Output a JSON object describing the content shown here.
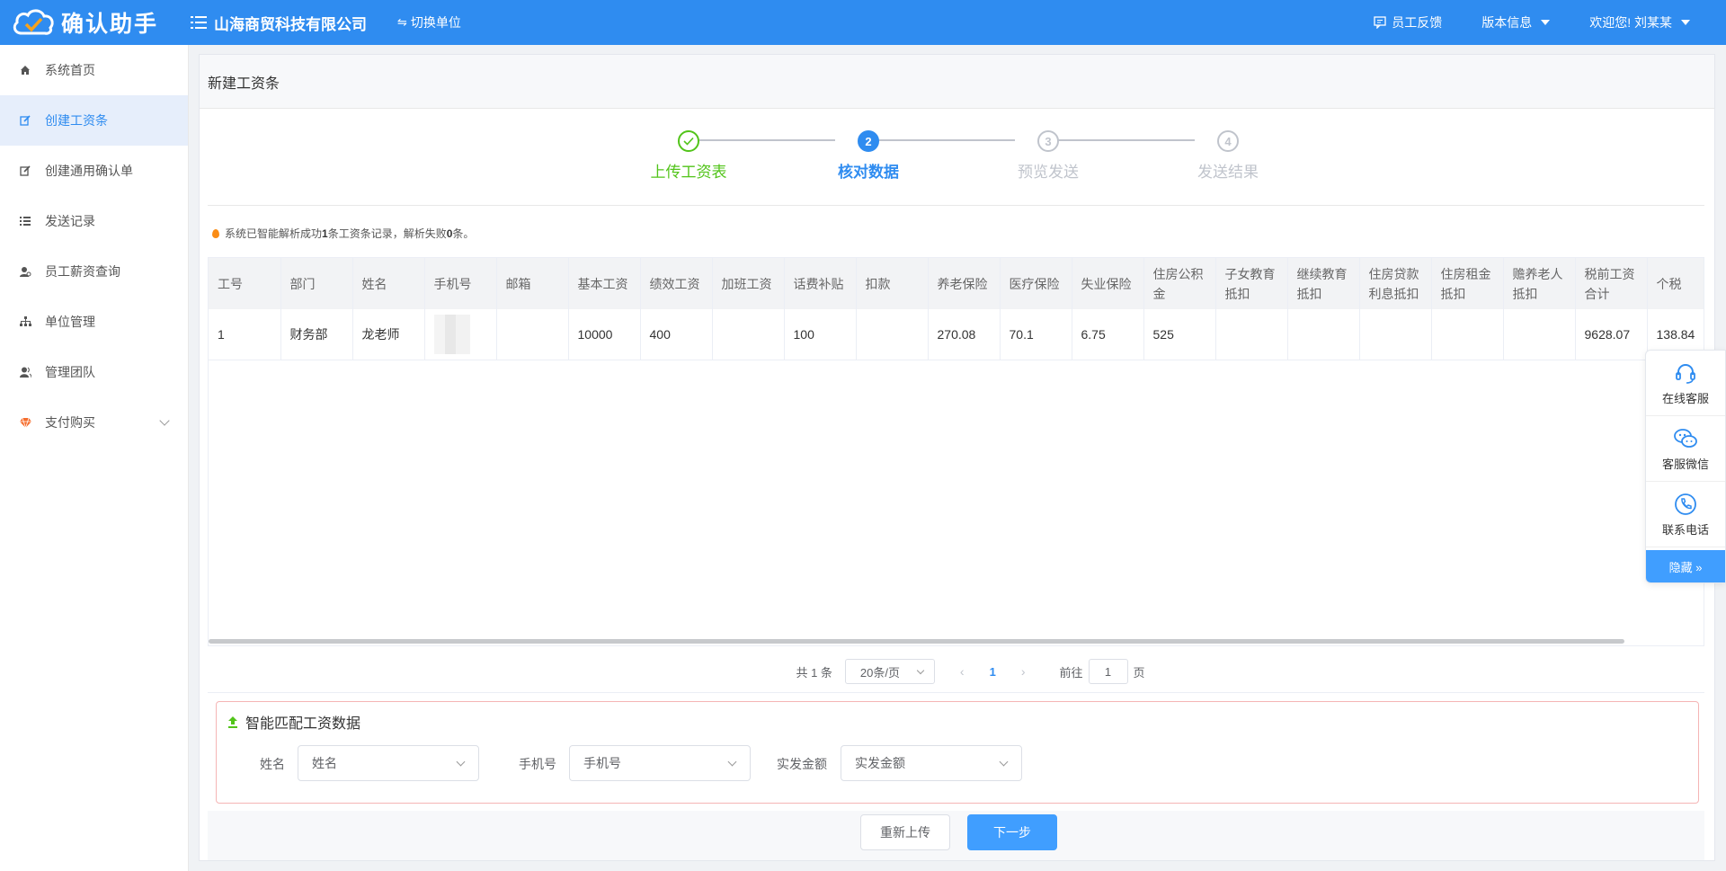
{
  "header": {
    "app_name": "确认助手",
    "company": "山海商贸科技有限公司",
    "switch_unit": "切换单位",
    "feedback": "员工反馈",
    "version": "版本信息",
    "welcome": "欢迎您! 刘某某"
  },
  "sidebar": {
    "items": [
      {
        "label": "系统首页",
        "icon": "home-icon"
      },
      {
        "label": "创建工资条",
        "icon": "edit-icon"
      },
      {
        "label": "创建通用确认单",
        "icon": "edit-icon"
      },
      {
        "label": "发送记录",
        "icon": "list-icon"
      },
      {
        "label": "员工薪资查询",
        "icon": "user-search-icon"
      },
      {
        "label": "单位管理",
        "icon": "org-icon"
      },
      {
        "label": "管理团队",
        "icon": "team-icon"
      },
      {
        "label": "支付购买",
        "icon": "diamond-icon"
      }
    ],
    "active_index": 1
  },
  "page": {
    "title": "新建工资条",
    "steps": [
      {
        "num": "1",
        "label": "上传工资表",
        "state": "done"
      },
      {
        "num": "2",
        "label": "核对数据",
        "state": "active"
      },
      {
        "num": "3",
        "label": "预览发送",
        "state": "wait"
      },
      {
        "num": "4",
        "label": "发送结果",
        "state": "wait"
      }
    ],
    "notice_prefix": "系统已智能解析成功",
    "notice_success": "1",
    "notice_mid": "条工资条记录，解析失败",
    "notice_fail": "0",
    "notice_suffix": "条。"
  },
  "table": {
    "columns": [
      "工号",
      "部门",
      "姓名",
      "手机号",
      "邮箱",
      "基本工资",
      "绩效工资",
      "加班工资",
      "话费补贴",
      "扣款",
      "养老保险",
      "医疗保险",
      "失业保险",
      "住房公积金",
      "子女教育抵扣",
      "继续教育抵扣",
      "住房贷款利息抵扣",
      "住房租金抵扣",
      "赡养老人抵扣",
      "税前工资合计",
      "个税"
    ],
    "rows": [
      [
        "1",
        "财务部",
        "龙老师",
        "",
        "",
        "10000",
        "400",
        "",
        "100",
        "",
        "270.08",
        "70.1",
        "6.75",
        "525",
        "",
        "",
        "",
        "",
        "",
        "9628.07",
        "138.84"
      ]
    ]
  },
  "pagination": {
    "total": "共 1 条",
    "page_size": "20条/页",
    "current": "1",
    "goto_label": "前往",
    "goto_value": "1",
    "page_unit": "页"
  },
  "match": {
    "title": "智能匹配工资数据",
    "fields": [
      {
        "label": "姓名",
        "value": "姓名"
      },
      {
        "label": "手机号",
        "value": "手机号"
      },
      {
        "label": "实发金额",
        "value": "实发金额"
      }
    ]
  },
  "buttons": {
    "reupload": "重新上传",
    "next": "下一步"
  },
  "service": {
    "online": "在线客服",
    "wechat": "客服微信",
    "phone": "联系电话",
    "hide": "隐藏 »"
  },
  "colors": {
    "primary": "#2f8cf0",
    "button_primary": "#409eff",
    "success": "#52c41a",
    "notice": "#fa8c16"
  }
}
